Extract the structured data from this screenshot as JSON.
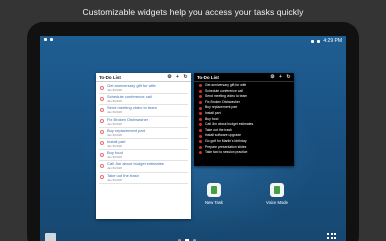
{
  "caption": "Customizable widgets help you access your tasks quickly",
  "status_bar": {
    "time": "4:29 PM"
  },
  "widget_list": {
    "title": "To-Do List",
    "tasks": [
      {
        "name": "Get anniversary gift for wife",
        "date": "Jan 8/2018"
      },
      {
        "name": "Schedule conference call",
        "date": "Jan 8/2018"
      },
      {
        "name": "Send meeting video to team",
        "date": "Jan 8/2018"
      },
      {
        "name": "Fix Broken Dishwasher",
        "date": "Jan 8/2018"
      },
      {
        "name": "Buy replacement part",
        "date": "Jan 8/2018"
      },
      {
        "name": "Install part",
        "date": "Jan 8/2018"
      },
      {
        "name": "Buy food",
        "date": "Jan 8/2018"
      },
      {
        "name": "Call Jim about budget estimates",
        "date": "Jan 8/2018"
      },
      {
        "name": "Take out the trash",
        "date": "Jan 8/2018"
      }
    ]
  },
  "widget_black": {
    "title": "To-Do List",
    "tasks": [
      "Get anniversary gift for wife",
      "Schedule conference call",
      "Send meeting video to team",
      "Fix Broken Dishwasher",
      "Buy replacement part",
      "Install part",
      "Buy food",
      "Call Jim about budget estimates",
      "Take out the trash",
      "Install software upgrade",
      "Go golf for Martin's birthday",
      "Prepare presentation slides",
      "Take taxi to session practice"
    ]
  },
  "shortcuts": {
    "new_task": "New Task",
    "voice_mode": "Voice Mode"
  },
  "colors": {
    "accent_link": "#3a6fb0",
    "check_red": "#d32f2f",
    "icon_green": "#43a047"
  }
}
